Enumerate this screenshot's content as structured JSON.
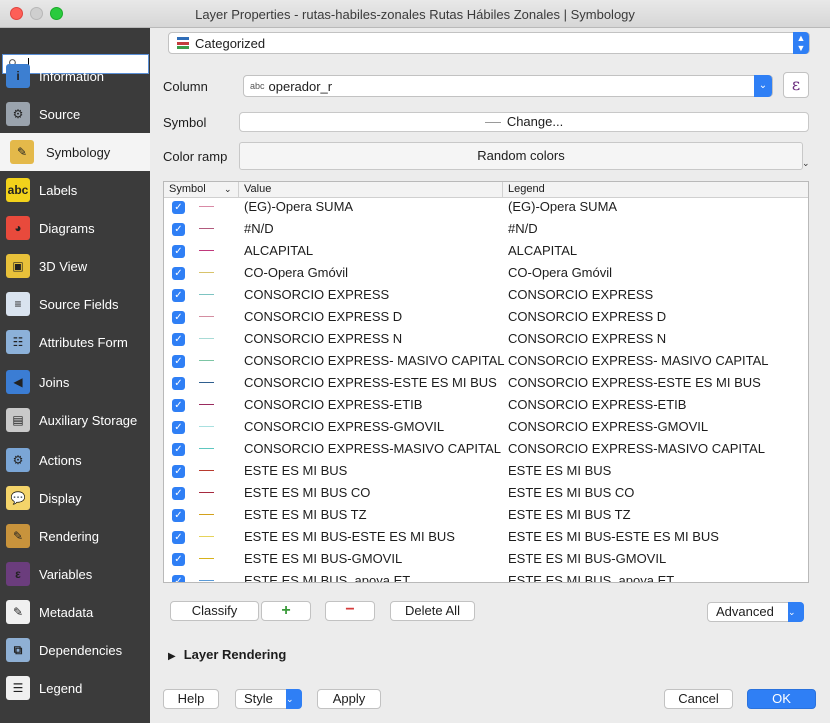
{
  "window": {
    "title": "Layer Properties - rutas-habiles-zonales Rutas Hábiles Zonales | Symbology"
  },
  "sidebar": {
    "search_value": "",
    "items": [
      {
        "label": "Information",
        "icon": "info-icon",
        "color": "#3d7fd1",
        "glyph": "i"
      },
      {
        "label": "Source",
        "icon": "wrench-icon",
        "color": "#9aa3ad",
        "glyph": "⚙"
      },
      {
        "label": "Symbology",
        "icon": "paintbrush-icon",
        "color": "#e4b94a",
        "glyph": "✎"
      },
      {
        "label": "Labels",
        "icon": "labels-icon",
        "color": "#f2d21b",
        "glyph": "abc"
      },
      {
        "label": "Diagrams",
        "icon": "diagram-icon",
        "color": "#e84a3c",
        "glyph": "◕"
      },
      {
        "label": "3D View",
        "icon": "cube-icon",
        "color": "#e8c13a",
        "glyph": "▣"
      },
      {
        "label": "Source Fields",
        "icon": "fields-icon",
        "color": "#d9e3ef",
        "glyph": "≡"
      },
      {
        "label": "Attributes Form",
        "icon": "form-icon",
        "color": "#8cb1d9",
        "glyph": "☷"
      },
      {
        "label": "Joins",
        "icon": "joins-icon",
        "color": "#3b7dd4",
        "glyph": "◀"
      },
      {
        "label": "Auxiliary Storage",
        "icon": "storage-icon",
        "color": "#c9c9c9",
        "glyph": "▤"
      },
      {
        "label": "Actions",
        "icon": "actions-icon",
        "color": "#7ba6d6",
        "glyph": "⚙"
      },
      {
        "label": "Display",
        "icon": "display-icon",
        "color": "#f4d46a",
        "glyph": "💬"
      },
      {
        "label": "Rendering",
        "icon": "brush-icon",
        "color": "#c8933c",
        "glyph": "✎"
      },
      {
        "label": "Variables",
        "icon": "variables-icon",
        "color": "#6b3d7d",
        "glyph": "ε"
      },
      {
        "label": "Metadata",
        "icon": "metadata-icon",
        "color": "#f0f0f0",
        "glyph": "✎"
      },
      {
        "label": "Dependencies",
        "icon": "dependencies-icon",
        "color": "#8fb0d4",
        "glyph": "⧉"
      },
      {
        "label": "Legend",
        "icon": "legend-icon",
        "color": "#f0f0f0",
        "glyph": "☰"
      }
    ],
    "selected": "Symbology"
  },
  "renderer": {
    "value": "Categorized"
  },
  "form": {
    "column_label": "Column",
    "column_type": "abc",
    "column_value": "operador_r",
    "symbol_label": "Symbol",
    "symbol_button": "Change...",
    "color_ramp_label": "Color ramp",
    "color_ramp_value": "Random colors"
  },
  "table": {
    "headers": {
      "symbol": "Symbol",
      "value": "Value",
      "legend": "Legend"
    },
    "rows": [
      {
        "value": "(EG)-Opera SUMA",
        "legend": "(EG)-Opera SUMA",
        "color": "#d98aa6"
      },
      {
        "value": "#N/D",
        "legend": "#N/D",
        "color": "#b25a7d"
      },
      {
        "value": "ALCAPITAL",
        "legend": "ALCAPITAL",
        "color": "#c0387b"
      },
      {
        "value": "CO-Opera Gmóvil",
        "legend": "CO-Opera Gmóvil",
        "color": "#d8c36b"
      },
      {
        "value": "CONSORCIO EXPRESS",
        "legend": "CONSORCIO EXPRESS",
        "color": "#7dc4c2"
      },
      {
        "value": "CONSORCIO EXPRESS D",
        "legend": "CONSORCIO EXPRESS D",
        "color": "#d48ea1"
      },
      {
        "value": "CONSORCIO EXPRESS N",
        "legend": "CONSORCIO EXPRESS N",
        "color": "#a8dbd6"
      },
      {
        "value": "CONSORCIO EXPRESS- MASIVO CAPITAL",
        "legend": "CONSORCIO EXPRESS- MASIVO CAPITAL",
        "color": "#7cc5a4"
      },
      {
        "value": "CONSORCIO EXPRESS-ESTE ES MI BUS",
        "legend": "CONSORCIO EXPRESS-ESTE ES MI BUS",
        "color": "#2f5f8f"
      },
      {
        "value": "CONSORCIO EXPRESS-ETIB",
        "legend": "CONSORCIO EXPRESS-ETIB",
        "color": "#9a2b5e"
      },
      {
        "value": "CONSORCIO EXPRESS-GMOVIL",
        "legend": "CONSORCIO EXPRESS-GMOVIL",
        "color": "#a9e0e0"
      },
      {
        "value": "CONSORCIO EXPRESS-MASIVO CAPITAL",
        "legend": "CONSORCIO EXPRESS-MASIVO CAPITAL",
        "color": "#5ec7c0"
      },
      {
        "value": "ESTE ES MI BUS",
        "legend": "ESTE ES MI BUS",
        "color": "#b83a2e"
      },
      {
        "value": "ESTE ES MI BUS CO",
        "legend": "ESTE ES MI BUS CO",
        "color": "#a62a3f"
      },
      {
        "value": "ESTE ES MI BUS TZ",
        "legend": "ESTE ES MI BUS TZ",
        "color": "#d3a11c"
      },
      {
        "value": "ESTE ES MI BUS-ESTE ES MI BUS",
        "legend": "ESTE ES MI BUS-ESTE ES MI BUS",
        "color": "#e6d35a"
      },
      {
        "value": "ESTE ES MI BUS-GMOVIL",
        "legend": "ESTE ES MI BUS-GMOVIL",
        "color": "#d7b21b"
      },
      {
        "value": "ESTE ES MI BUS_apoya ET",
        "legend": "ESTE ES MI BUS_apoya ET",
        "color": "#5a9ad6"
      }
    ]
  },
  "buttons": {
    "classify": "Classify",
    "add": "+",
    "remove": "−",
    "delete_all": "Delete All",
    "advanced": "Advanced",
    "layer_rendering": "Layer Rendering",
    "help": "Help",
    "style": "Style",
    "apply": "Apply",
    "cancel": "Cancel",
    "ok": "OK"
  }
}
